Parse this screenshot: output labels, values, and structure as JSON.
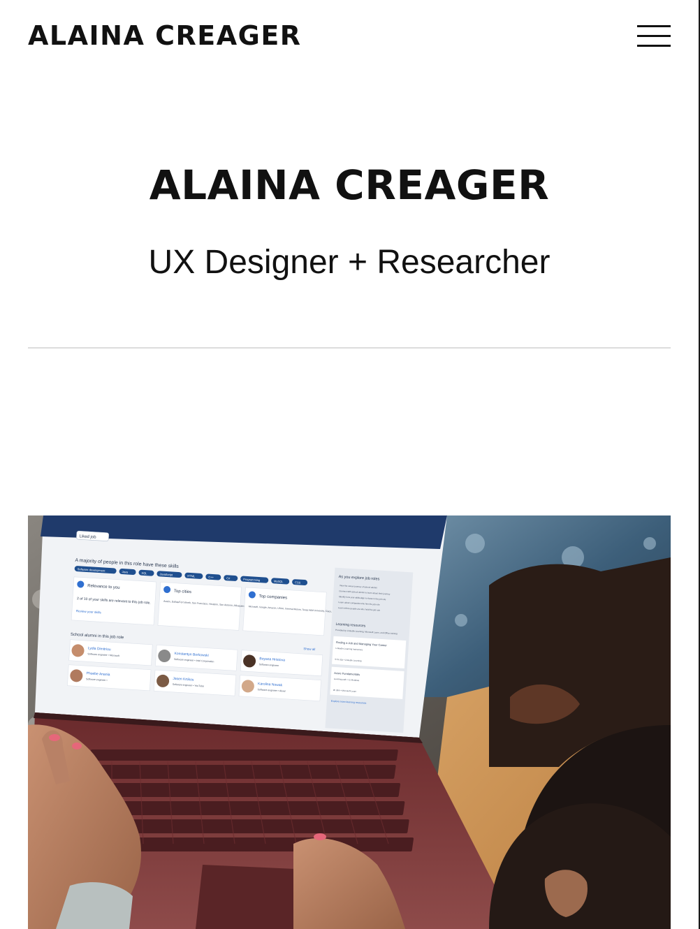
{
  "header": {
    "site_name": "ALAINA CREAGER",
    "menu_icon": "hamburger-menu-icon"
  },
  "hero": {
    "title": "ALAINA CREAGER",
    "subtitle": "UX Designer + Researcher"
  },
  "project_image": {
    "screen": {
      "chip": "Liked job",
      "skills_heading": "A majority of people in this role have these skills",
      "skills": [
        "Software development",
        "Java",
        "SQL",
        "JavaScript",
        "HTML",
        "C++",
        "C#",
        "Programming",
        "MySQL",
        "CSS"
      ],
      "relevance_title": "Relevance to you",
      "relevance_text": "2 of 10 of your skills are relevant to this job role.",
      "relevance_link": "Review your skills",
      "cities_title": "Top cities",
      "cities_text": "Austin, Dallas/Fort Worth, San Francisco, Houston, San Antonio, Albuquerque, Denver, Saudi Arabia",
      "companies_title": "Top companies",
      "companies_text": "Microsoft, Google, Amazon, USAA, General Motors, Texas A&M University, Cisco, Facebook, Lockheed Martin, IBM",
      "alumni_heading": "School alumni in this job role",
      "show_all": "Show all",
      "alumni": [
        {
          "name": "Lydia Dimitriou",
          "role": "Software engineer • Microsoft"
        },
        {
          "name": "Konstantyn Borkowski",
          "role": "Software engineer • Intel Corporation"
        },
        {
          "name": "Boyana Hristova",
          "role": "Software engineer"
        },
        {
          "name": "Phoebe Anania",
          "role": "Software engineer •"
        },
        {
          "name": "Jasen Krtikos",
          "role": "Software engineer • YouTube"
        },
        {
          "name": "Karolina Nowak",
          "role": "Software engineer • Akvel"
        }
      ],
      "side_heading": "As you explore job roles",
      "side_items": [
        "View the career journey of school alumni",
        "Connect with school alumni to learn about their journey",
        "Identify how your skills align to those in the job role",
        "Learn about companies who hire the job role",
        "Learn where people are who hold the job role"
      ],
      "learning_heading": "Learning resources",
      "learning_sub": "Provided by LinkedIn Learning, Microsoft Learn, and Office training",
      "course1_title": "Finding a Job and Managing Your Career",
      "course1_meta": "LinkedIn Learning Instructors",
      "course1_stats": "57m 32s • LinkedIn Learning",
      "course2_title": "Azure Fundamentals",
      "course2_meta": "Learning path • 11 Modules",
      "course2_stats": "9h 33m • Microsoft Learn",
      "explore_link": "Explore more learning resources"
    }
  }
}
